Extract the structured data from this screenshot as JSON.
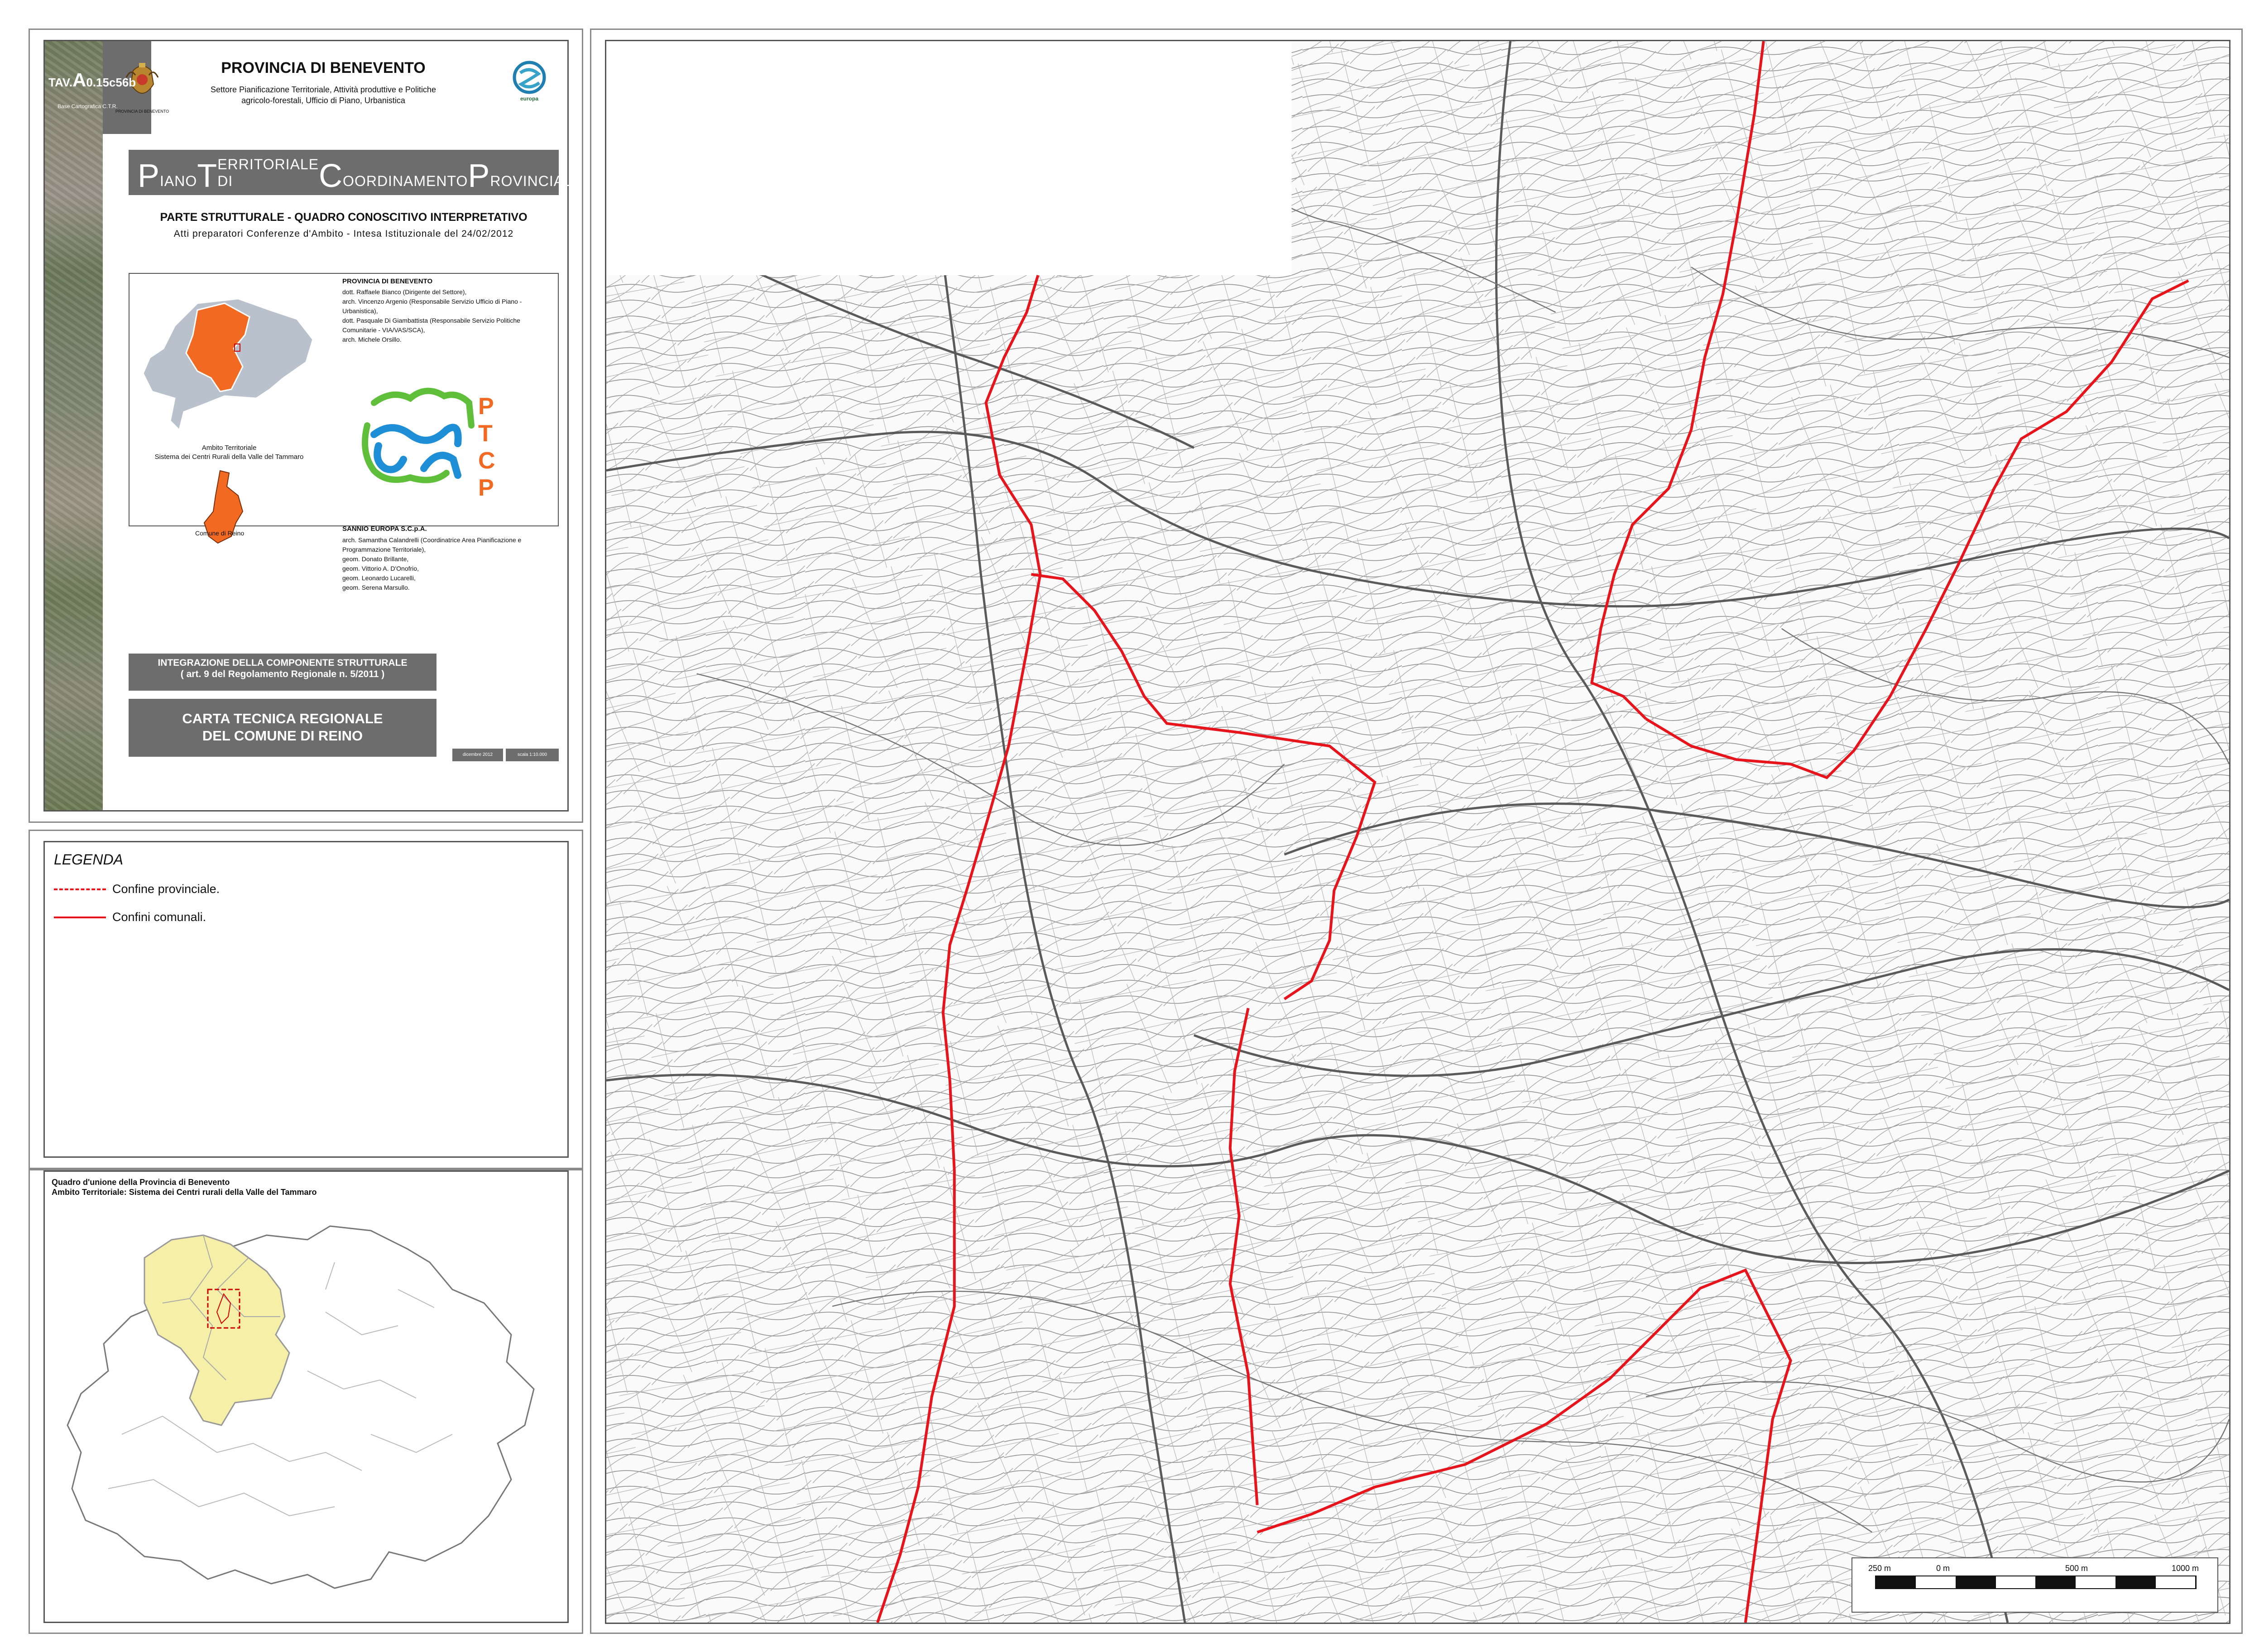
{
  "header": {
    "province_title": "PROVINCIA DI BENEVENTO",
    "sector_text": "Settore Pianificazione Territoriale, Attività produttive e Politiche agricolo-forestali, Ufficio di Piano, Urbanistica",
    "coat_caption": "PROVINCIA DI BENEVENTO",
    "europa_caption": "europa",
    "ptcp_banner": {
      "w1_initial": "P",
      "w1_rest": "IANO ",
      "w2_initial": "T",
      "w2_rest": "ERRITORIALE DI ",
      "w3_initial": "C",
      "w3_rest": "OORDINAMENTO ",
      "w4_initial": "P",
      "w4_rest": "ROVINCIALE"
    },
    "parte_title": "PARTE STRUTTURALE - QUADRO CONOSCITIVO INTERPRETATIVO",
    "atti_text": "Atti preparatori Conferenze d'Ambito - Intesa Istituzionale del 24/02/2012"
  },
  "credits": {
    "ambito_caption": "Ambito Territoriale\nSistema dei Centri Rurali della Valle del Tammaro",
    "reino_caption": "Comune di Reino",
    "prov_heading": "PROVINCIA DI BENEVENTO",
    "prov_text": "dott. Raffaele Bianco (Dirigente del Settore),\narch. Vincenzo Argenio (Responsabile Servizio Ufficio di Piano - Urbanistica),\ndott. Pasquale Di Giambattista (Responsabile Servizio Politiche Comunitarie - VIA/VAS/SCA),\narch. Michele Orsillo.",
    "ptcp_letters": [
      "P",
      "T",
      "C",
      "P"
    ],
    "sannio_heading": "SANNIO EUROPA S.C.p.A.",
    "sannio_text": "arch. Samantha Calandrelli (Coordinatrice Area Pianificazione e Programmazione Territoriale),\ngeom. Donato Brillante,\ngeom. Vittorio A. D'Onofrio,\ngeom. Leonardo Lucarelli,\ngeom. Serena Marsullo."
  },
  "title_block": {
    "integrazione_line1": "INTEGRAZIONE DELLA COMPONENTE STRUTTURALE",
    "integrazione_line2": "( art. 9 del Regolamento Regionale n. 5/2011 )",
    "carta_line1": "CARTA TECNICA REGIONALE",
    "carta_line2": "DEL COMUNE DI REINO",
    "tav_prefix": "TAV.",
    "tav_big": "A",
    "tav_code": "0.15c56b",
    "tav_sub": "Base Cartografica C.T.R.",
    "date": "dicembre 2012",
    "scale": "scala 1:10.000"
  },
  "legend": {
    "title": "LEGENDA",
    "items": [
      {
        "label": "Confine provinciale.",
        "color": "#e8141c",
        "style": "dashed"
      },
      {
        "label": "Confini comunali.",
        "color": "#e8141c",
        "style": "solid"
      }
    ]
  },
  "overview": {
    "title_line1_prefix": "Quadro d'unione della ",
    "title_line1_bold": "Provincia di Benevento",
    "title_line2_prefix": "Ambito Territoriale: ",
    "title_line2_bold": "Sistema dei Centri rurali della Valle del Tammaro",
    "highlight_color": "#f5efa8"
  },
  "map": {
    "boundary_color": "#e8141c",
    "scale_bar": {
      "ticks": [
        "250 m",
        "0 m",
        "500 m",
        "1000 m"
      ]
    }
  },
  "colors": {
    "panel_grey": "#6d6d6d",
    "orange": "#f26a21",
    "ambito_grey": "#b9c2cc",
    "ptcp_green": "#5fbf3a",
    "ptcp_blue": "#1e8fd6"
  }
}
